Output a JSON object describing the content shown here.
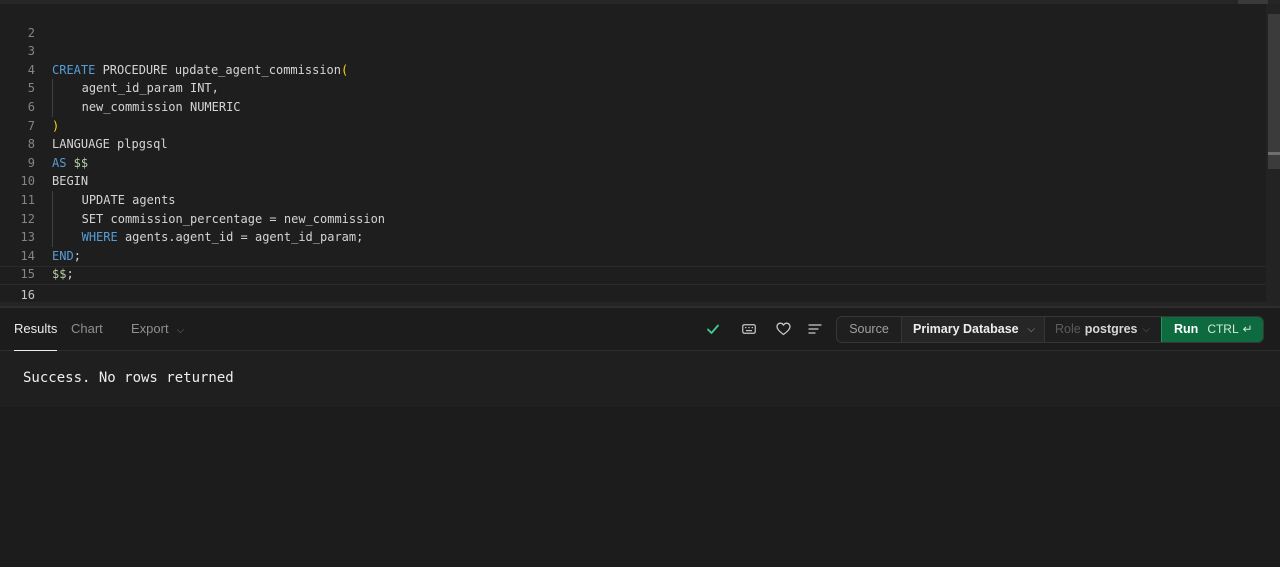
{
  "editor": {
    "lines": [
      {
        "num": "2"
      },
      {
        "num": "3"
      },
      {
        "num": "4"
      },
      {
        "num": "5"
      },
      {
        "num": "6"
      },
      {
        "num": "7"
      },
      {
        "num": "8"
      },
      {
        "num": "9"
      },
      {
        "num": "10"
      },
      {
        "num": "11"
      },
      {
        "num": "12"
      },
      {
        "num": "13"
      },
      {
        "num": "14"
      },
      {
        "num": "15"
      },
      {
        "num": "16"
      }
    ],
    "tokens": {
      "l3_create": "CREATE",
      "l3_rest": " PROCEDURE update_agent_commission",
      "l3_paren": "(",
      "l4_text": "agent_id_param INT,",
      "l5_text": "new_commission NUMERIC",
      "l6_paren": ")",
      "l7_text": "LANGUAGE plpgsql",
      "l8_as": "AS",
      "l8_dollar": " $$",
      "l9_text": "BEGIN",
      "l10_text": "UPDATE agents",
      "l11_text": "SET commission_percentage = new_commission",
      "l12_where": "WHERE",
      "l12_rest": " agents.agent_id = agent_id_param;",
      "l13_end": "END",
      "l13_semi": ";",
      "l14_dollar": "$$",
      "l14_semi": ";"
    }
  },
  "toolbar": {
    "tabs": {
      "results": "Results",
      "chart": "Chart",
      "export": "Export"
    },
    "source_label": "Source",
    "database": "Primary Database",
    "role_label": "Role",
    "role_value": "postgres",
    "run_label": "Run",
    "run_shortcut": "CTRL",
    "run_return_glyph": "↵",
    "chevron_glyph": "⌵"
  },
  "result": {
    "message": "Success. No rows returned"
  },
  "colors": {
    "keyword": "#569cd6",
    "bracket": "#ffd700",
    "dollar_quote": "#b5cea8",
    "run_button": "#0e6b40",
    "success_check": "#3ecf8e"
  },
  "icons": [
    "check-icon",
    "keyboard-icon",
    "heart-icon",
    "align-left-icon",
    "chevron-down-icon",
    "return-icon"
  ]
}
